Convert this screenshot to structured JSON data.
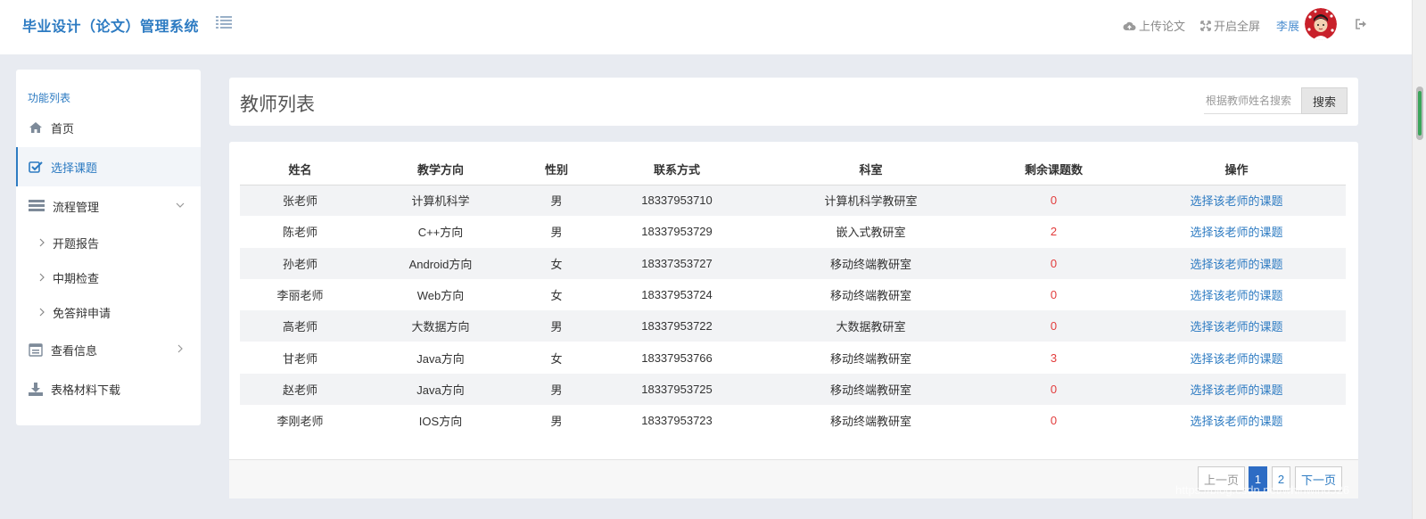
{
  "header": {
    "app_title": "毕业设计（论文）管理系统",
    "upload_label": "上传论文",
    "fullscreen_label": "开启全屏",
    "user_name": "李展"
  },
  "sidebar": {
    "caption": "功能列表",
    "items": [
      {
        "label": "首页",
        "icon": "home-icon"
      },
      {
        "label": "选择课题",
        "icon": "check-square-icon"
      },
      {
        "label": "流程管理",
        "icon": "list-icon"
      },
      {
        "label": "查看信息",
        "icon": "info-card-icon"
      },
      {
        "label": "表格材料下载",
        "icon": "download-icon"
      }
    ],
    "subitems": [
      {
        "label": "开题报告"
      },
      {
        "label": "中期检查"
      },
      {
        "label": "免答辩申请"
      }
    ]
  },
  "main": {
    "title": "教师列表",
    "search_placeholder": "根据教师姓名搜索",
    "search_button": "搜索"
  },
  "table": {
    "headers": [
      "姓名",
      "教学方向",
      "性别",
      "联系方式",
      "科室",
      "剩余课题数",
      "操作"
    ],
    "rows": [
      {
        "name": "张老师",
        "direction": "计算机科学",
        "gender": "男",
        "phone": "18337953710",
        "dept": "计算机科学教研室",
        "remaining": "0",
        "action": "选择该老师的课题"
      },
      {
        "name": "陈老师",
        "direction": "C++方向",
        "gender": "男",
        "phone": "18337953729",
        "dept": "嵌入式教研室",
        "remaining": "2",
        "action": "选择该老师的课题"
      },
      {
        "name": "孙老师",
        "direction": "Android方向",
        "gender": "女",
        "phone": "18337353727",
        "dept": "移动终端教研室",
        "remaining": "0",
        "action": "选择该老师的课题"
      },
      {
        "name": "李丽老师",
        "direction": "Web方向",
        "gender": "女",
        "phone": "18337953724",
        "dept": "移动终端教研室",
        "remaining": "0",
        "action": "选择该老师的课题"
      },
      {
        "name": "高老师",
        "direction": "大数据方向",
        "gender": "男",
        "phone": "18337953722",
        "dept": "大数据教研室",
        "remaining": "0",
        "action": "选择该老师的课题"
      },
      {
        "name": "甘老师",
        "direction": "Java方向",
        "gender": "女",
        "phone": "18337953766",
        "dept": "移动终端教研室",
        "remaining": "3",
        "action": "选择该老师的课题"
      },
      {
        "name": "赵老师",
        "direction": "Java方向",
        "gender": "男",
        "phone": "18337953725",
        "dept": "移动终端教研室",
        "remaining": "0",
        "action": "选择该老师的课题"
      },
      {
        "name": "李刚老师",
        "direction": "IOS方向",
        "gender": "男",
        "phone": "18337953723",
        "dept": "移动终端教研室",
        "remaining": "0",
        "action": "选择该老师的课题"
      }
    ]
  },
  "pagination": {
    "prev": "上一页",
    "pages": [
      "1",
      "2"
    ],
    "current": "1",
    "next": "下一页"
  },
  "watermark": "https://blog.csdn.net/whirlwind526",
  "colors": {
    "accent": "#2d7bc2",
    "warning_number": "#e23b3b",
    "page_background": "#e8ebf1"
  }
}
